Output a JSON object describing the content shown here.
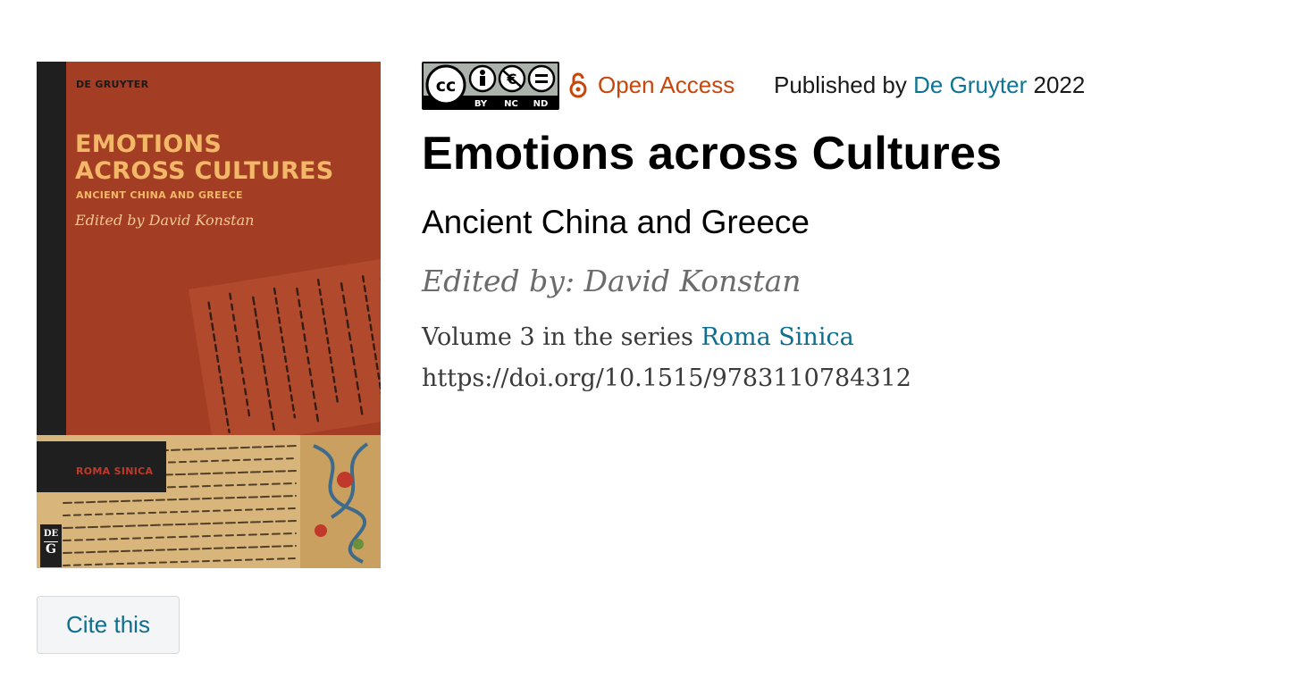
{
  "cover": {
    "publisher": "DE GRUYTER",
    "title_line1": "EMOTIONS",
    "title_line2": "ACROSS CULTURES",
    "subtitle": "ANCIENT CHINA AND GREECE",
    "editor": "Edited by David Konstan",
    "series": "ROMA SINICA",
    "logo_top": "DE",
    "logo_bottom": "G"
  },
  "license": {
    "cc_label": "cc",
    "terms": [
      "BY",
      "NC",
      "ND"
    ]
  },
  "access": {
    "label": "Open Access",
    "published_prefix": "Published by ",
    "publisher_link": "De Gruyter",
    "year": " 2022"
  },
  "book": {
    "title": "Emotions across Cultures",
    "subtitle": "Ancient China and Greece",
    "edited_by": "Edited by: David Konstan",
    "series_prefix": "Volume 3 in the series ",
    "series_link": "Roma Sinica",
    "doi": "https://doi.org/10.1515/9783110784312"
  },
  "actions": {
    "cite_label": "Cite this"
  },
  "colors": {
    "cover_red": "#a33d23",
    "cover_gold": "#f2b868",
    "open_access_orange": "#c9460a",
    "link_teal": "#0e7496"
  }
}
